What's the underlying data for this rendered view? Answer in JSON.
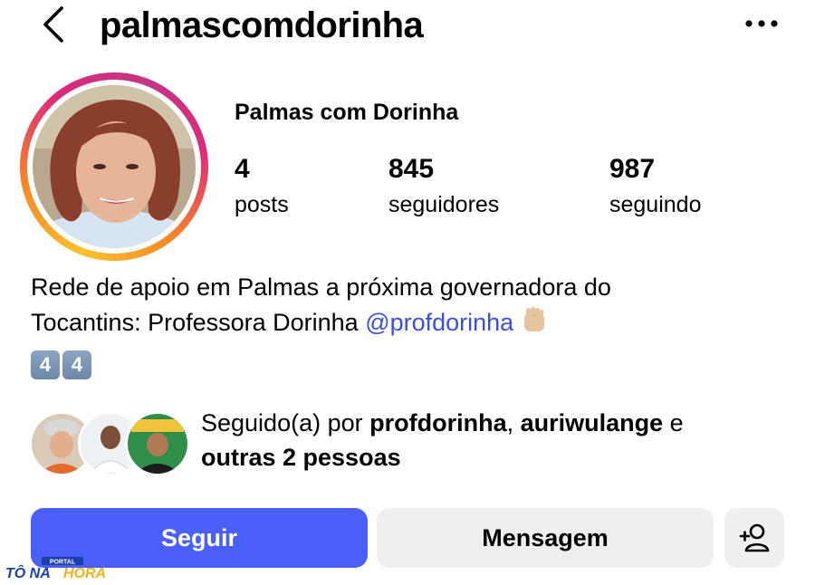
{
  "header": {
    "username": "palmascomdorinha",
    "back_icon": "chevron-left-icon",
    "more_icon": "ellipsis-icon"
  },
  "profile": {
    "display_name": "Palmas com Dorinha",
    "stats": [
      {
        "value": "4",
        "label": "posts"
      },
      {
        "value": "845",
        "label": "seguidores"
      },
      {
        "value": "987",
        "label": "seguindo"
      }
    ]
  },
  "bio": {
    "line1": "Rede de apoio em Palmas a próxima governadora do",
    "line2": "Tocantins: Professora Dorinha ",
    "mention": "@profdorinha",
    "keycaps": [
      "4",
      "4"
    ]
  },
  "followed_by": {
    "prefix": "Seguido(a) por ",
    "user1": "profdorinha",
    "sep": ", ",
    "user2": "auriwulange",
    "and": " e",
    "others": "outras 2 pessoas"
  },
  "actions": {
    "follow": "Seguir",
    "message": "Mensagem"
  },
  "watermark": {
    "top": "PORTAL",
    "brand1": "TÔ NA",
    "brand2": "HORA"
  },
  "colors": {
    "follow_button": "#4a5ff7",
    "mention": "#3b4fd8",
    "secondary_button": "#efeff2"
  }
}
